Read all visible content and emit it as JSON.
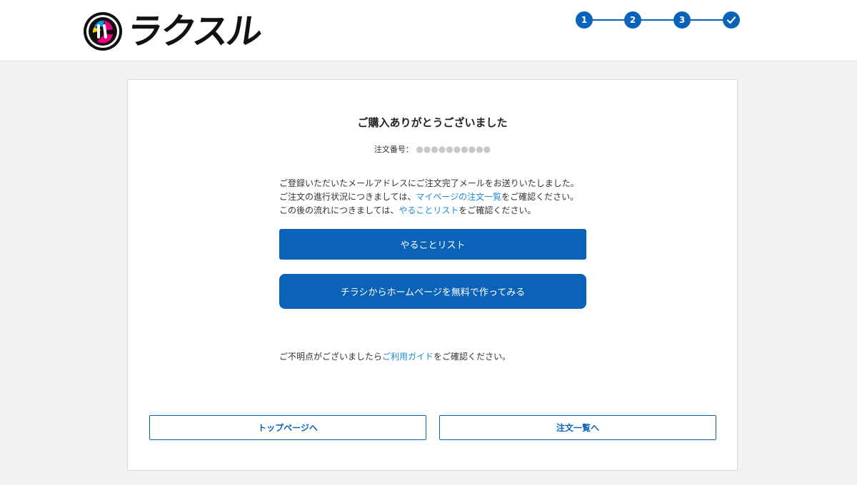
{
  "brand": {
    "logo_text": "ラクスル"
  },
  "steps": [
    {
      "label": "1"
    },
    {
      "label": "2"
    },
    {
      "label": "3"
    },
    {
      "label": "✓",
      "icon": "check-icon"
    }
  ],
  "colors": {
    "accent": "#0a63b8",
    "link": "#1a8ad4"
  },
  "card": {
    "title": "ご購入ありがとうございました",
    "order_label": "注文番号：",
    "order_mask": "●●●●●●●●●●",
    "message": {
      "line1": "ご登録いただいたメールアドレスにご注文完了メールをお送りいたしました。",
      "line2_pre": "ご注文の進行状況につきましては、",
      "line2_link": "マイページの注文一覧",
      "line2_post": "をご確認ください。",
      "line3_pre": "この後の流れにつきましては、",
      "line3_link": "やることリスト",
      "line3_post": "をご確認ください。"
    },
    "todo_button": "やることリスト",
    "flyer_button": "チラシからホームページを無料で作ってみる",
    "guide": {
      "pre": "ご不明点がございましたら",
      "link": "ご利用ガイド",
      "post": "をご確認ください。"
    },
    "top_button": "トップページへ",
    "orders_button": "注文一覧へ"
  }
}
